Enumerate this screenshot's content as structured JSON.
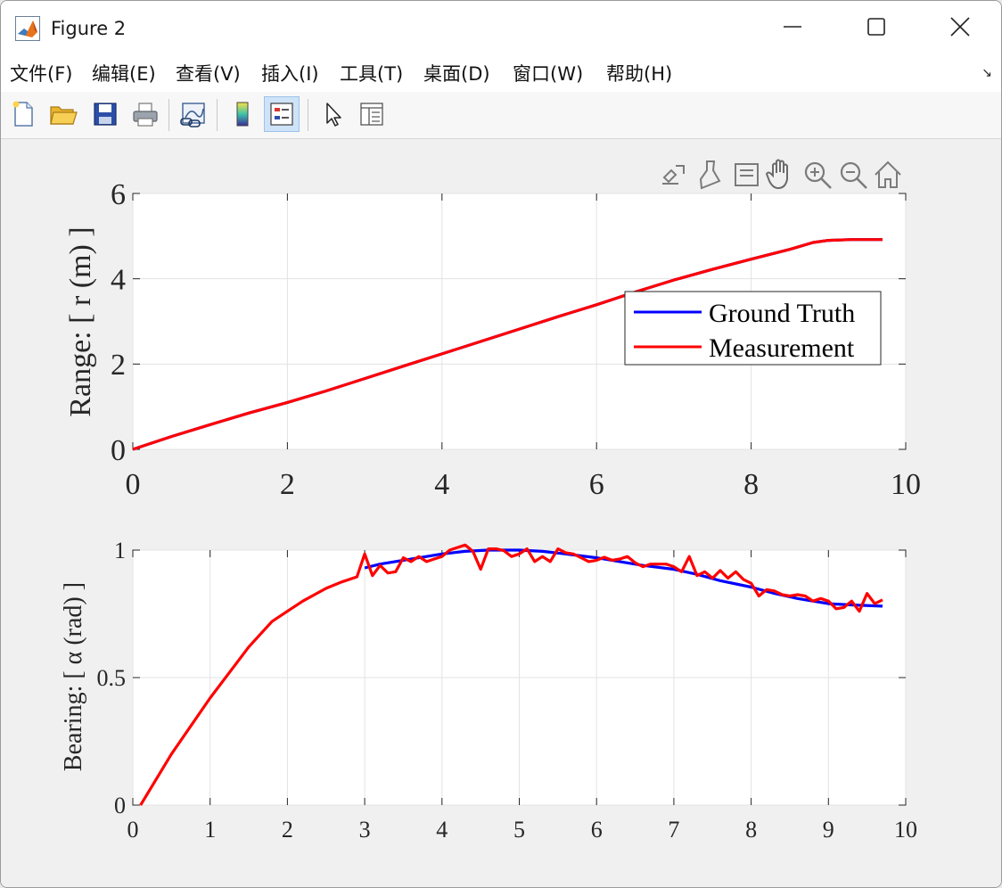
{
  "window": {
    "title": "Figure 2"
  },
  "menu": [
    {
      "label": "文件(F)"
    },
    {
      "label": "编辑(E)"
    },
    {
      "label": "查看(V)"
    },
    {
      "label": "插入(I)"
    },
    {
      "label": "工具(T)"
    },
    {
      "label": "桌面(D)"
    },
    {
      "label": "窗口(W)"
    },
    {
      "label": "帮助(H)"
    }
  ],
  "colors": {
    "ground_truth": "#0000ff",
    "measurement": "#ff0000",
    "grid": "#e3e3e3"
  },
  "chart_data": [
    {
      "type": "line",
      "title": "",
      "xlabel": "",
      "ylabel": "Range: [ r (m) ]",
      "xlim": [
        0,
        10
      ],
      "ylim": [
        0,
        6
      ],
      "xticks": [
        "0",
        "2",
        "4",
        "6",
        "8",
        "10"
      ],
      "yticks": [
        "0",
        "2",
        "4",
        "6"
      ],
      "grid": true,
      "legend": {
        "placement": "right",
        "entries": [
          "Ground Truth",
          "Measurement"
        ]
      },
      "series": [
        {
          "name": "Ground Truth",
          "x": [
            0,
            0.5,
            1,
            1.5,
            2,
            2.5,
            3,
            3.5,
            4,
            4.5,
            5,
            5.5,
            6,
            6.5,
            7,
            7.5,
            8,
            8.5,
            8.8,
            9,
            9.3,
            9.7
          ],
          "y": [
            0,
            0.3,
            0.58,
            0.85,
            1.1,
            1.37,
            1.66,
            1.95,
            2.24,
            2.53,
            2.82,
            3.11,
            3.39,
            3.69,
            3.97,
            4.22,
            4.46,
            4.69,
            4.85,
            4.9,
            4.92,
            4.92
          ]
        },
        {
          "name": "Measurement",
          "x": [
            0,
            0.5,
            1,
            1.5,
            2,
            2.5,
            3,
            3.5,
            4,
            4.5,
            5,
            5.5,
            6,
            6.5,
            7,
            7.5,
            8,
            8.5,
            8.8,
            9,
            9.3,
            9.7
          ],
          "y": [
            0,
            0.3,
            0.58,
            0.85,
            1.1,
            1.37,
            1.66,
            1.95,
            2.24,
            2.53,
            2.82,
            3.11,
            3.39,
            3.69,
            3.97,
            4.22,
            4.46,
            4.69,
            4.85,
            4.9,
            4.92,
            4.92
          ]
        }
      ]
    },
    {
      "type": "line",
      "title": "",
      "xlabel": "",
      "ylabel": "Bearing: [ α (rad) ]",
      "xlim": [
        0,
        10
      ],
      "ylim": [
        0,
        1
      ],
      "xticks": [
        "0",
        "1",
        "2",
        "3",
        "4",
        "5",
        "6",
        "7",
        "8",
        "9",
        "10"
      ],
      "yticks": [
        "0",
        "0.5",
        "1"
      ],
      "grid": true,
      "series": [
        {
          "name": "Ground Truth",
          "x": [
            3.0,
            3.2,
            3.5,
            3.8,
            4.0,
            4.3,
            4.6,
            5.0,
            5.3,
            5.6,
            6.0,
            6.3,
            6.6,
            7.0,
            7.3,
            7.6,
            8.0,
            8.3,
            8.6,
            9.0,
            9.3,
            9.7
          ],
          "y": [
            0.93,
            0.945,
            0.96,
            0.975,
            0.985,
            0.995,
            1.0,
            1.0,
            0.995,
            0.985,
            0.97,
            0.955,
            0.94,
            0.925,
            0.905,
            0.88,
            0.855,
            0.83,
            0.81,
            0.79,
            0.785,
            0.78
          ]
        },
        {
          "name": "Measurement",
          "x": [
            0.1,
            0.5,
            1.0,
            1.5,
            1.8,
            2.0,
            2.2,
            2.5,
            2.7,
            2.9,
            3.0,
            3.1,
            3.2,
            3.3,
            3.4,
            3.5,
            3.6,
            3.7,
            3.8,
            3.9,
            4.0,
            4.1,
            4.2,
            4.3,
            4.4,
            4.5,
            4.6,
            4.7,
            4.8,
            4.9,
            5.0,
            5.1,
            5.2,
            5.3,
            5.4,
            5.5,
            5.6,
            5.7,
            5.8,
            5.9,
            6.0,
            6.1,
            6.2,
            6.3,
            6.4,
            6.5,
            6.6,
            6.7,
            6.8,
            6.9,
            7.0,
            7.1,
            7.2,
            7.3,
            7.4,
            7.5,
            7.6,
            7.7,
            7.8,
            7.9,
            8.0,
            8.1,
            8.2,
            8.3,
            8.4,
            8.5,
            8.6,
            8.7,
            8.8,
            8.9,
            9.0,
            9.1,
            9.2,
            9.3,
            9.4,
            9.5,
            9.6,
            9.7
          ],
          "y": [
            0.0,
            0.2,
            0.42,
            0.62,
            0.72,
            0.76,
            0.8,
            0.85,
            0.875,
            0.895,
            0.985,
            0.9,
            0.94,
            0.91,
            0.915,
            0.97,
            0.955,
            0.975,
            0.955,
            0.965,
            0.975,
            1.0,
            1.01,
            1.02,
            0.995,
            0.925,
            1.005,
            1.005,
            0.998,
            0.975,
            0.985,
            1.005,
            0.955,
            0.975,
            0.955,
            1.005,
            0.99,
            0.985,
            0.97,
            0.955,
            0.96,
            0.972,
            0.96,
            0.965,
            0.975,
            0.95,
            0.935,
            0.945,
            0.945,
            0.945,
            0.935,
            0.915,
            0.975,
            0.9,
            0.915,
            0.89,
            0.92,
            0.89,
            0.915,
            0.885,
            0.87,
            0.82,
            0.845,
            0.84,
            0.825,
            0.82,
            0.825,
            0.82,
            0.8,
            0.81,
            0.8,
            0.77,
            0.775,
            0.8,
            0.76,
            0.83,
            0.79,
            0.805
          ]
        }
      ]
    }
  ]
}
